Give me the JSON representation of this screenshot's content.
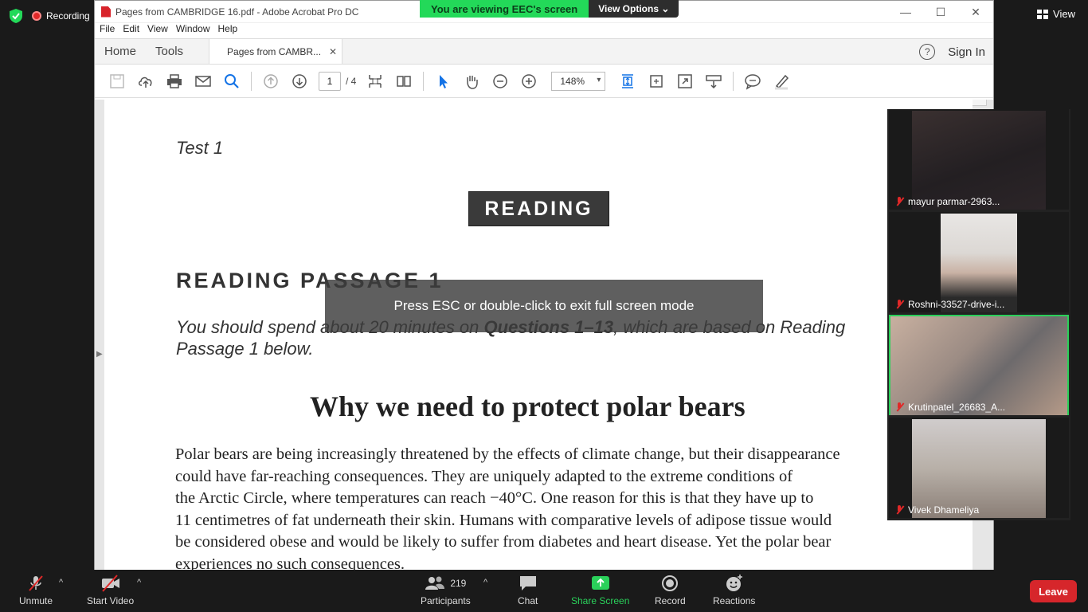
{
  "zoom": {
    "recording_label": "Recording",
    "view_label": "View",
    "share_banner_text": "You are viewing EEC's screen",
    "view_options_label": "View Options",
    "esc_message": "Press ESC or double-click to exit full screen mode",
    "participants": [
      {
        "name": "mayur parmar-2963...",
        "muted": true
      },
      {
        "name": "Roshni-33527-drive-i...",
        "muted": true
      },
      {
        "name": "Krutinpatel_26683_A...",
        "muted": true,
        "active": true
      },
      {
        "name": "Vivek Dhameliya",
        "muted": true
      }
    ],
    "controls": {
      "unmute": "Unmute",
      "start_video": "Start Video",
      "participants": "Participants",
      "participants_count": "219",
      "chat": "Chat",
      "share_screen": "Share Screen",
      "record": "Record",
      "reactions": "Reactions",
      "leave": "Leave"
    }
  },
  "acrobat": {
    "window_title": "Pages from CAMBRIDGE 16.pdf - Adobe Acrobat Pro DC",
    "menu": [
      "File",
      "Edit",
      "View",
      "Window",
      "Help"
    ],
    "nav_home": "Home",
    "nav_tools": "Tools",
    "doc_tab": "Pages from CAMBR...",
    "sign_in": "Sign In",
    "help_glyph": "?",
    "page_current": "1",
    "page_total": "/ 4",
    "zoom_level": "148%"
  },
  "document": {
    "test_label": "Test 1",
    "section": "READING",
    "passage_heading": "READING PASSAGE 1",
    "instruction_a": "You should spend about 20 minutes on ",
    "instruction_b": "Questions 1–13",
    "instruction_c": ", which are based on Reading",
    "instruction_d": "Passage 1 below.",
    "title": "Why we need to protect polar bears",
    "body_lines": [
      "Polar bears are being increasingly threatened by the effects of climate change, but their disappearance",
      "could have far-reaching consequences. They are uniquely adapted to the extreme conditions of",
      "the Arctic Circle, where temperatures can reach −40°C. One reason for this is that they have up to",
      "11 centimetres of fat underneath their skin. Humans with comparative levels of adipose tissue would",
      "be considered obese and would be likely to suffer from diabetes and heart disease. Yet the polar bear",
      "experiences no such consequences."
    ]
  },
  "colors": {
    "zoom_green": "#23d959",
    "leave_red": "#d6262b",
    "acrobat_blue": "#1473e6"
  }
}
